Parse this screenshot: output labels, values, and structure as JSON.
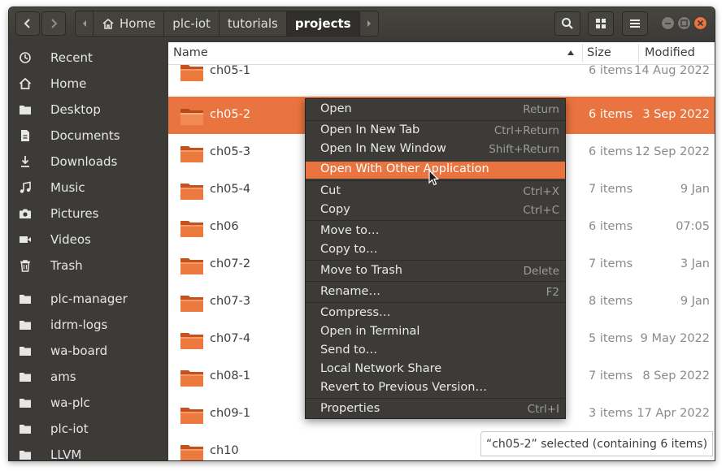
{
  "window": {
    "breadcrumbs": [
      "Home",
      "plc-iot",
      "tutorials",
      "projects"
    ],
    "controls": {
      "minimize": "minimize-icon",
      "maximize": "maximize-icon",
      "close": "close-icon"
    },
    "accent_color": "#e9743f"
  },
  "sidebar": {
    "items": [
      {
        "label": "Recent",
        "icon": "clock-icon"
      },
      {
        "label": "Home",
        "icon": "home-icon"
      },
      {
        "label": "Desktop",
        "icon": "folder-icon"
      },
      {
        "label": "Documents",
        "icon": "document-icon"
      },
      {
        "label": "Downloads",
        "icon": "download-icon"
      },
      {
        "label": "Music",
        "icon": "music-icon"
      },
      {
        "label": "Pictures",
        "icon": "camera-icon"
      },
      {
        "label": "Videos",
        "icon": "video-icon"
      },
      {
        "label": "Trash",
        "icon": "trash-icon"
      },
      {
        "label": "plc-manager",
        "icon": "folder-icon"
      },
      {
        "label": "idrm-logs",
        "icon": "folder-icon"
      },
      {
        "label": "wa-board",
        "icon": "folder-icon"
      },
      {
        "label": "ams",
        "icon": "folder-icon"
      },
      {
        "label": "wa-plc",
        "icon": "folder-icon"
      },
      {
        "label": "plc-iot",
        "icon": "folder-icon"
      },
      {
        "label": "LLVM",
        "icon": "folder-icon"
      }
    ]
  },
  "columns": {
    "name": "Name",
    "size": "Size",
    "modified": "Modified"
  },
  "files": [
    {
      "name": "ch05-1",
      "size": "6 items",
      "modified": "14 Aug 2022"
    },
    {
      "name": "ch05-2",
      "size": "6 items",
      "modified": "3 Sep 2022"
    },
    {
      "name": "ch05-3",
      "size": "6 items",
      "modified": "12 Sep 2022"
    },
    {
      "name": "ch05-4",
      "size": "7 items",
      "modified": "9 Jan"
    },
    {
      "name": "ch06",
      "size": "6 items",
      "modified": "07:05"
    },
    {
      "name": "ch07-2",
      "size": "7 items",
      "modified": "3 Jan"
    },
    {
      "name": "ch07-3",
      "size": "8 items",
      "modified": "9 Jan"
    },
    {
      "name": "ch07-4",
      "size": "5 items",
      "modified": "9 May 2022"
    },
    {
      "name": "ch08-1",
      "size": "7 items",
      "modified": "8 Sep 2022"
    },
    {
      "name": "ch09-1",
      "size": "3 items",
      "modified": "17 Apr 2022"
    },
    {
      "name": "ch10",
      "size": "",
      "modified": ""
    }
  ],
  "context_menu": {
    "items": [
      {
        "label": "Open",
        "shortcut": "Return"
      },
      {
        "label": "Open In New Tab",
        "shortcut": "Ctrl+Return"
      },
      {
        "label": "Open In New Window",
        "shortcut": "Shift+Return"
      },
      {
        "label": "Open With Other Application",
        "shortcut": ""
      },
      {
        "label": "Cut",
        "shortcut": "Ctrl+X"
      },
      {
        "label": "Copy",
        "shortcut": "Ctrl+C"
      },
      {
        "label": "Move to…",
        "shortcut": ""
      },
      {
        "label": "Copy to…",
        "shortcut": ""
      },
      {
        "label": "Move to Trash",
        "shortcut": "Delete"
      },
      {
        "label": "Rename…",
        "shortcut": "F2"
      },
      {
        "label": "Compress…",
        "shortcut": ""
      },
      {
        "label": "Open in Terminal",
        "shortcut": ""
      },
      {
        "label": "Send to…",
        "shortcut": ""
      },
      {
        "label": "Local Network Share",
        "shortcut": ""
      },
      {
        "label": "Revert to Previous Version…",
        "shortcut": ""
      },
      {
        "label": "Properties",
        "shortcut": "Ctrl+I"
      }
    ]
  },
  "status": "“ch05-2” selected  (containing 6 items)"
}
